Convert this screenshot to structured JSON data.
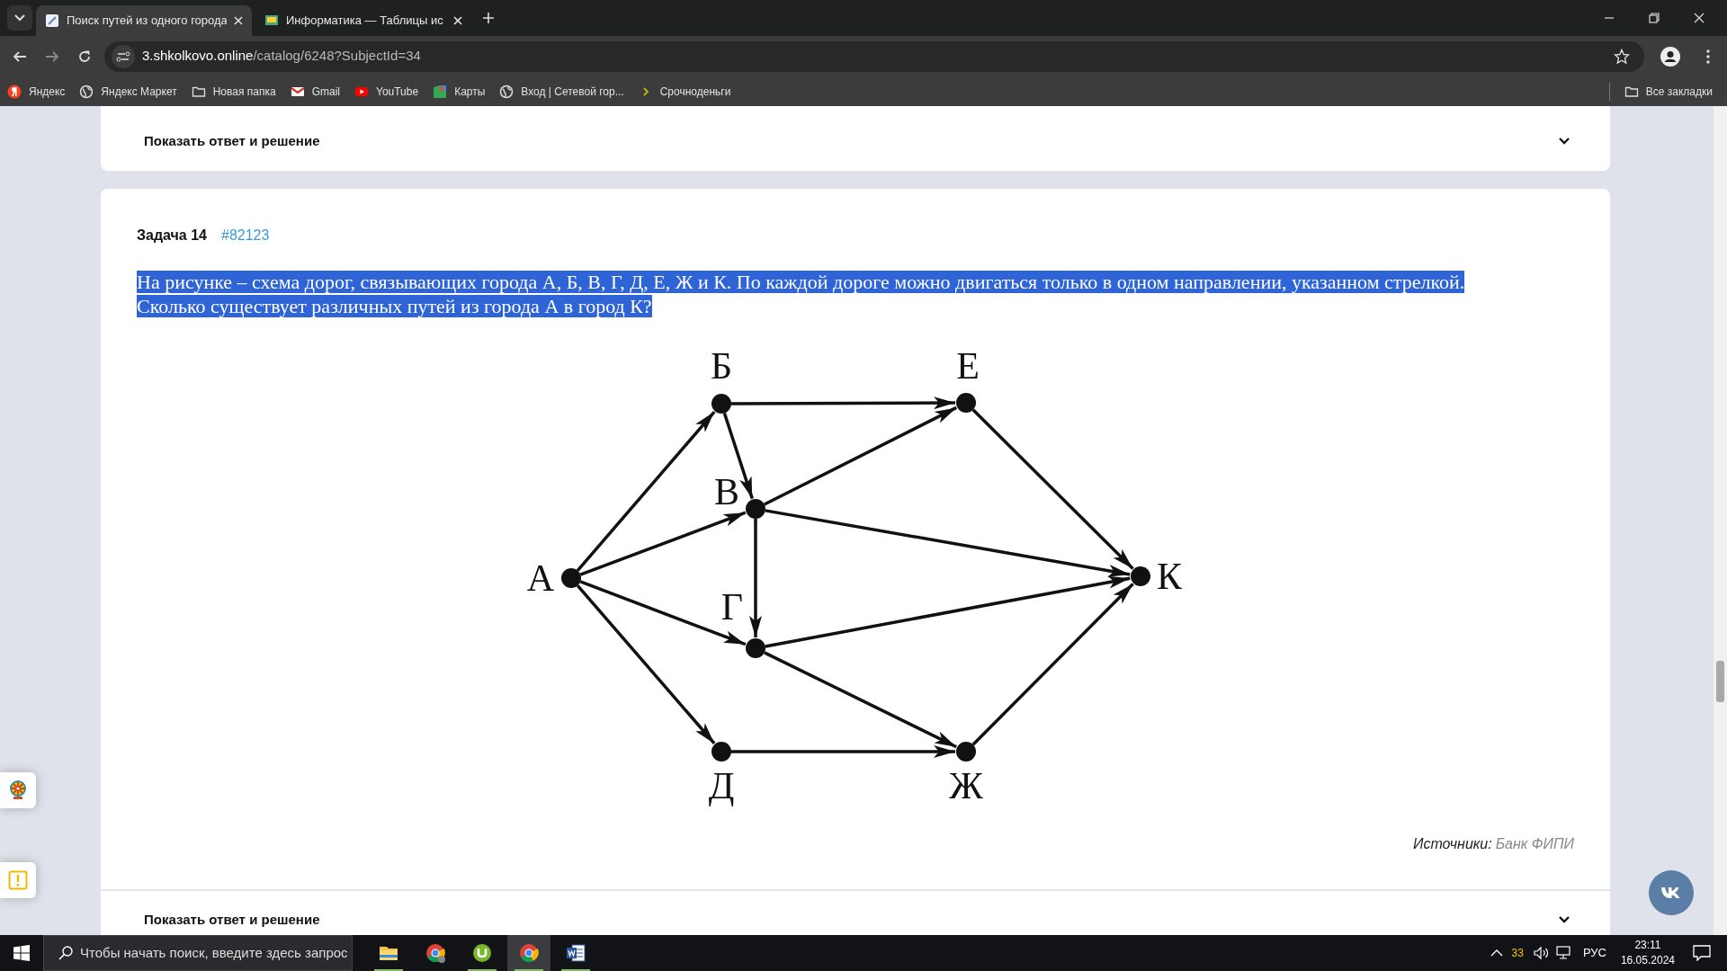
{
  "browser": {
    "tabs": [
      {
        "title": "Поиск путей из одного города",
        "selected": true
      },
      {
        "title": "Информатика — Таблицы ис",
        "selected": false
      }
    ],
    "address": {
      "host": "3.shkolkovo.online",
      "path": "/catalog/6248?SubjectId=34"
    },
    "bookmarks": [
      {
        "label": "Яндекс",
        "kind": "yandex"
      },
      {
        "label": "Яндекс Маркет",
        "kind": "globe"
      },
      {
        "label": "Новая папка",
        "kind": "folder"
      },
      {
        "label": "Gmail",
        "kind": "gmail"
      },
      {
        "label": "YouTube",
        "kind": "youtube"
      },
      {
        "label": "Карты",
        "kind": "maps"
      },
      {
        "label": "Вход | Сетевой гор...",
        "kind": "globe"
      },
      {
        "label": "Срочноденьги",
        "kind": "chevron"
      }
    ],
    "all_bookmarks": "Все закладки"
  },
  "page": {
    "top_toggle": "Показать ответ и решение",
    "task": {
      "title": "Задача 14",
      "number": "#82123",
      "question": "На рисунке – схема дорог, связывающих города А, Б, В, Г, Д, Е, Ж и К. По каждой дороге можно двигаться только в одном направлении, указанном стрелкой. Сколько существует различных путей из города А в город К?",
      "question_highlighted": true,
      "graph": {
        "nodes": [
          "А",
          "Б",
          "Е",
          "В",
          "Г",
          "К",
          "Д",
          "Ж"
        ]
      },
      "sources_label": "Источники:",
      "sources_link": "Банк ФИПИ"
    },
    "bottom_toggle": "Показать ответ и решение"
  },
  "taskbar": {
    "search_placeholder": "Чтобы начать поиск, введите здесь запрос",
    "apps": [
      {
        "kind": "explorer",
        "selected": false,
        "running": true
      },
      {
        "kind": "chrome-alt",
        "selected": false,
        "running": false
      },
      {
        "kind": "torrent",
        "selected": false,
        "running": true
      },
      {
        "kind": "chrome",
        "selected": true,
        "running": true
      },
      {
        "kind": "word",
        "selected": false,
        "running": true
      }
    ],
    "temperature": "33",
    "language": "РУС",
    "time": "23:11",
    "date": "16.05.2024"
  }
}
